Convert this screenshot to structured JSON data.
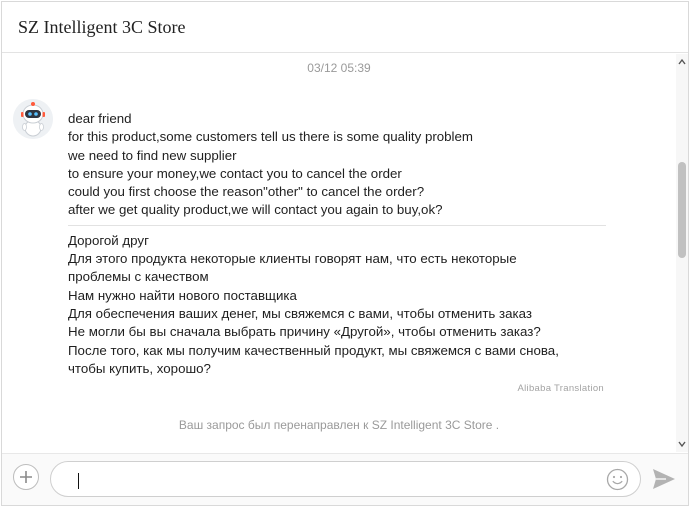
{
  "header": {
    "title": "SZ Intelligent 3C Store"
  },
  "chat": {
    "timestamp": "03/12 05:39",
    "message": {
      "original_lines": [
        "dear friend",
        "for this product,some customers tell us there is some quality problem",
        "we need to find new supplier",
        "to ensure your money,we contact you to cancel the order",
        "could you first choose the reason\"other\" to cancel the order?",
        "after we get quality product,we will contact you again to buy,ok?"
      ],
      "translated_lines": [
        "Дорогой друг",
        "Для этого продукта некоторые клиенты говорят нам, что есть некоторые",
        "проблемы с качеством",
        "Нам нужно найти нового поставщика",
        "Для обеспечения ваших денег, мы свяжемся с вами, чтобы отменить заказ",
        "Не могли бы вы сначала выбрать причину «Другой», чтобы отменить заказ?",
        "После того, как мы получим качественный продукт, мы свяжемся с вами снова,",
        "чтобы купить, хорошо?"
      ],
      "translation_label": "Alibaba Translation"
    },
    "system_note": "Ваш запрос был перенаправлен к SZ Intelligent 3C Store ."
  },
  "input": {
    "value": "",
    "placeholder": ""
  },
  "icons": {
    "add": "plus-circle-icon",
    "emoji": "smiley-icon",
    "send": "send-icon",
    "avatar": "robot-avatar-icon"
  },
  "colors": {
    "text": "#1f1f1f",
    "muted": "#9a9a9a",
    "border": "#d9d9d9",
    "scroll_thumb": "#c1c1c1"
  }
}
